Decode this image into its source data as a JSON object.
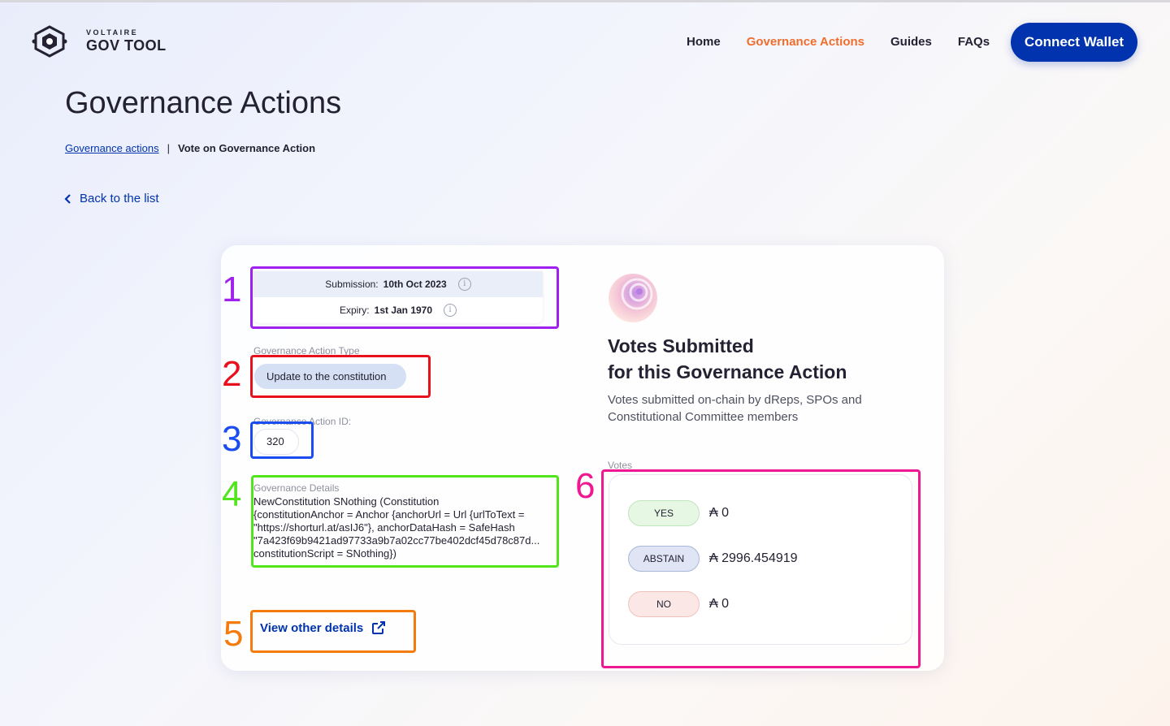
{
  "header": {
    "brand_small": "VOLTAIRE",
    "brand_big": "GOV TOOL",
    "nav": [
      {
        "label": "Home"
      },
      {
        "label": "Governance Actions"
      },
      {
        "label": "Guides"
      },
      {
        "label": "FAQs"
      }
    ],
    "connect_label": "Connect Wallet"
  },
  "page": {
    "title": "Governance Actions",
    "breadcrumb_link": "Governance actions",
    "breadcrumb_sep": "|",
    "breadcrumb_current": "Vote on Governance Action",
    "back_label": "Back to the list"
  },
  "action": {
    "submission_label": "Submission:",
    "submission_value": "10th Oct 2023",
    "expiry_label": "Expiry:",
    "expiry_value": "1st Jan 1970",
    "type_label": "Governance Action Type",
    "type_value": "Update to the constitution",
    "id_label": "Governance Action ID:",
    "id_value": "320",
    "details_label": "Governance Details",
    "details_lines": [
      "NewConstitution SNothing (Constitution",
      "{constitutionAnchor = Anchor {anchorUrl = Url {urlToText =",
      "\"https://shorturl.at/asIJ6\"}, anchorDataHash = SafeHash",
      "\"7a423f69b9421ad97733a9b7a02cc77be402dcf45d78c87d...",
      "constitutionScript = SNothing})"
    ],
    "view_link": "View other details"
  },
  "votes": {
    "title_line1": "Votes Submitted",
    "title_line2": "for this Governance Action",
    "description": "Votes submitted on-chain by dReps, SPOs and Constitutional Committee members",
    "label": "Votes",
    "rows": [
      {
        "label": "YES",
        "amount": "₳ 0"
      },
      {
        "label": "ABSTAIN",
        "amount": "₳ 2996.454919"
      },
      {
        "label": "NO",
        "amount": "₳ 0"
      }
    ]
  },
  "annotations": [
    {
      "number": "1",
      "color": "#a020f0"
    },
    {
      "number": "2",
      "color": "#e8101c"
    },
    {
      "number": "3",
      "color": "#1a4cf0"
    },
    {
      "number": "4",
      "color": "#52e51c"
    },
    {
      "number": "5",
      "color": "#f57c0c"
    },
    {
      "number": "6",
      "color": "#f01890"
    }
  ],
  "colors": {
    "primary": "#0033ad",
    "accent": "#f06e2b"
  }
}
